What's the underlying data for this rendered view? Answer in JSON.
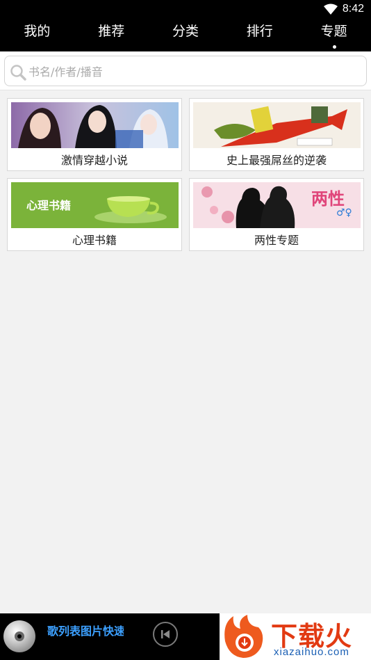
{
  "status_bar": {
    "time": "8:42",
    "wifi_icon": "wifi-icon"
  },
  "nav": {
    "tabs": [
      {
        "label": "我的",
        "active": false
      },
      {
        "label": "推荐",
        "active": false
      },
      {
        "label": "分类",
        "active": false
      },
      {
        "label": "排行",
        "active": false
      },
      {
        "label": "专题",
        "active": true
      }
    ]
  },
  "search": {
    "placeholder": "书名/作者/播音",
    "value": ""
  },
  "topics": [
    {
      "title": "激情穿越小说"
    },
    {
      "title": "史上最强屌丝的逆袭"
    },
    {
      "title": "心理书籍",
      "image_text": "心理书籍"
    },
    {
      "title": "两性专题",
      "image_text": "两性"
    }
  ],
  "player": {
    "now_playing": "歌列表图片快速",
    "prev_icon": "skip-previous-icon",
    "disc_icon": "disc-icon"
  },
  "watermark": {
    "brand": "下载火",
    "url": "xiazaihuo.com"
  },
  "colors": {
    "bar": "#000000",
    "background": "#f2f2f2",
    "marquee": "#3ca0ff",
    "watermark_red": "#e23a12"
  }
}
